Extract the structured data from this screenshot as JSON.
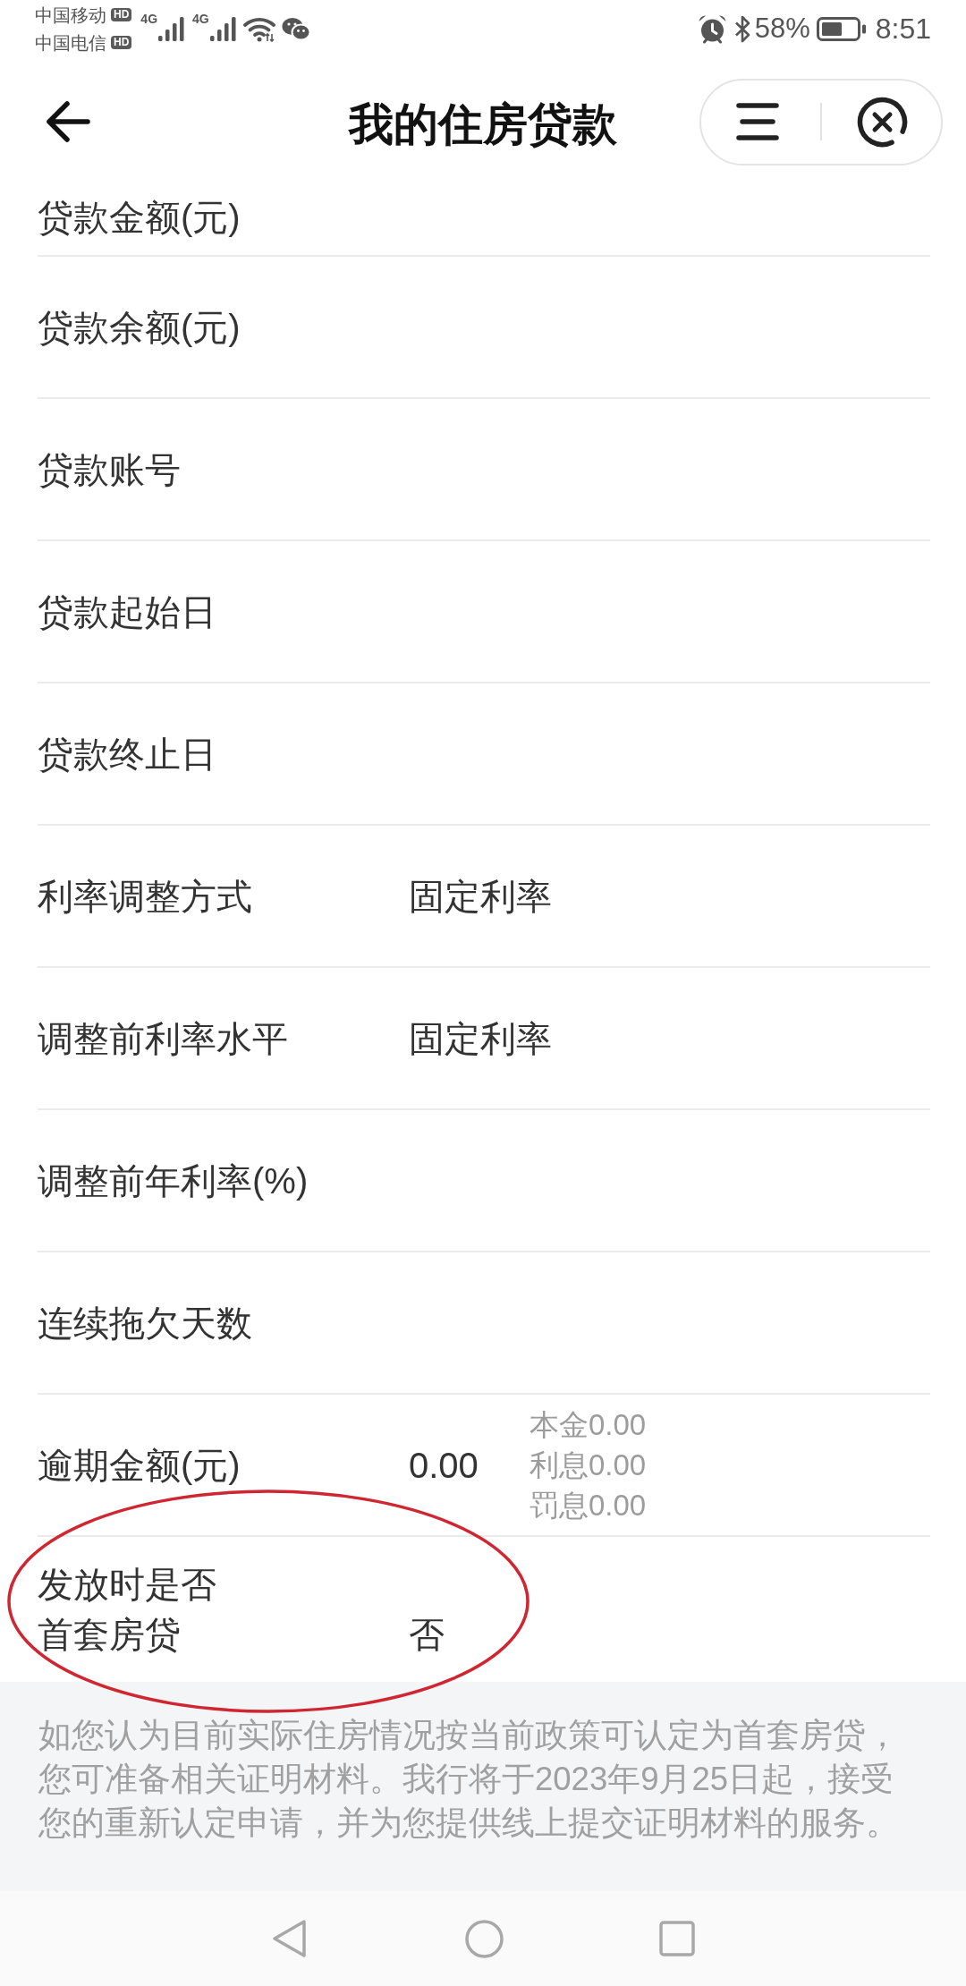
{
  "status_bar": {
    "carriers": [
      {
        "name": "中国移动",
        "badge": "HD"
      },
      {
        "name": "中国电信",
        "badge": "HD"
      }
    ],
    "networks": [
      {
        "label": "4G"
      },
      {
        "label": "4G"
      }
    ],
    "battery": "58%",
    "time": "8:51"
  },
  "header": {
    "title": "我的住房贷款"
  },
  "rows": [
    {
      "kind": "field",
      "label": "贷款金额(元)",
      "circled": false
    },
    {
      "kind": "field",
      "label": "贷款余额(元)",
      "circled": false
    },
    {
      "kind": "field",
      "label": "贷款账号",
      "circled": false
    },
    {
      "kind": "field",
      "label": "贷款起始日",
      "circled": false
    },
    {
      "kind": "field",
      "label": "贷款终止日",
      "circled": false
    },
    {
      "kind": "field",
      "label": "利率调整方式",
      "value": "固定利率",
      "circled": false
    },
    {
      "kind": "field",
      "label": "调整前利率水平",
      "value": "固定利率",
      "circled": false
    },
    {
      "kind": "field",
      "label": "调整前年利率(%)",
      "circled": false
    },
    {
      "kind": "field",
      "label": "连续拖欠天数",
      "circled": false
    },
    {
      "kind": "amount",
      "label": "逾期金额(元)",
      "value": "0.00",
      "breakdown": [
        "本金0.00",
        "利息0.00",
        "罚息0.00"
      ],
      "circled": false
    },
    {
      "kind": "wrapped",
      "label": "发放时是否首套房贷",
      "value": "否",
      "circled": true
    }
  ],
  "notice": "如您认为目前实际住房情况按当前政策可认定为首套房贷，您可准备相关证明材料。我行将于2023年9月25日起，接受您的重新认定申请，并为您提供线上提交证明材料的服务。"
}
